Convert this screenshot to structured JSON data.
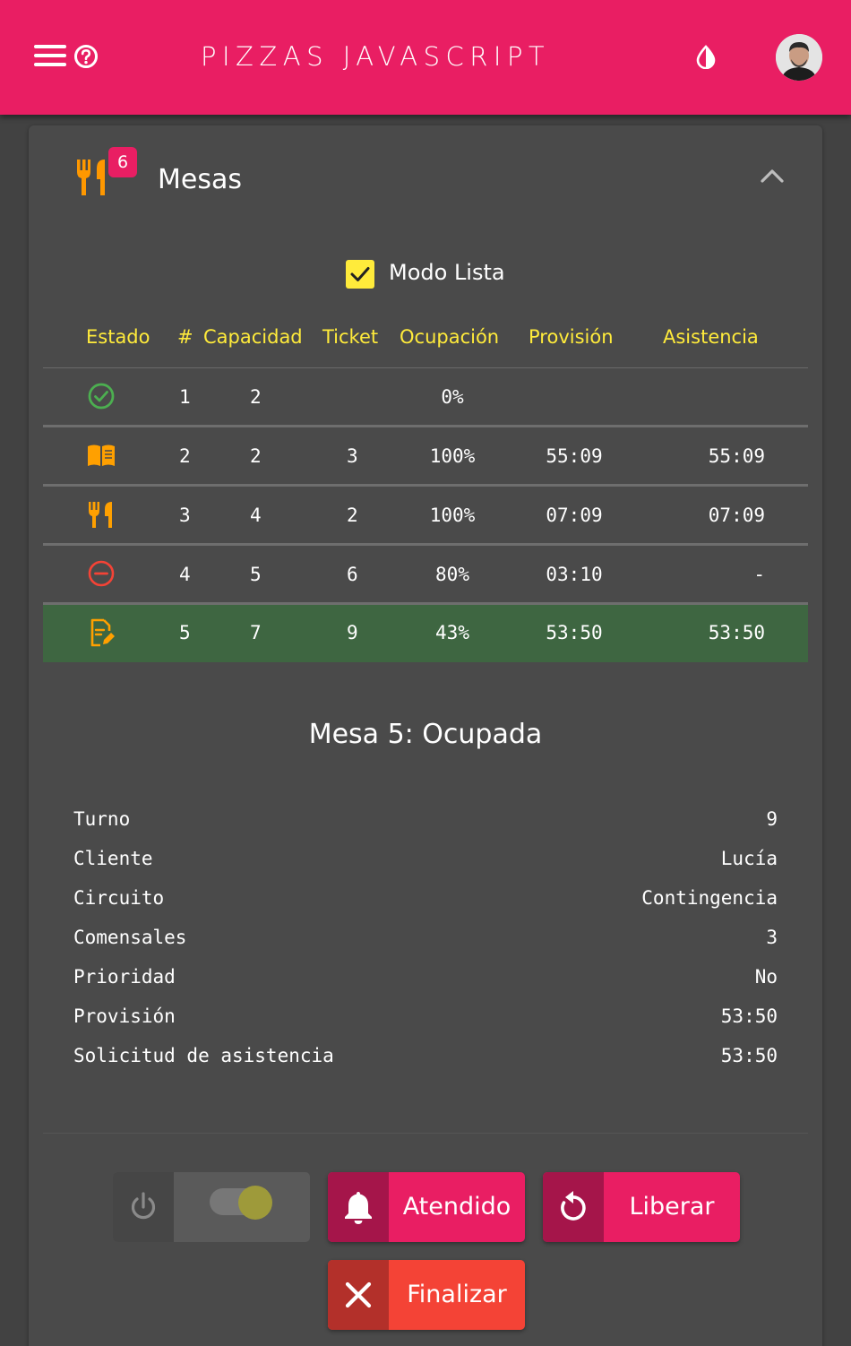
{
  "header": {
    "title": "PIZZAS JAVASCRIPT",
    "menu_icon": "menu-icon",
    "help_icon": "help-icon",
    "theme_icon": "contrast-icon",
    "avatar": "user-avatar"
  },
  "panel": {
    "title": "Mesas",
    "badge": "6",
    "icon": "utensils-icon",
    "collapse_icon": "chevron-up-icon"
  },
  "list_mode": {
    "label": "Modo Lista",
    "checked": true
  },
  "table": {
    "headers": [
      "Estado",
      "#",
      "Capacidad",
      "Ticket",
      "Ocupación",
      "Provisión",
      "Asistencia"
    ],
    "rows": [
      {
        "status": "check-circle-icon",
        "num": "1",
        "capacity": "2",
        "ticket": "",
        "occupancy": "0%",
        "provision": "",
        "assistance": ""
      },
      {
        "status": "menu-book-icon",
        "num": "2",
        "capacity": "2",
        "ticket": "3",
        "occupancy": "100%",
        "provision": "55:09",
        "assistance": "55:09"
      },
      {
        "status": "utensils-icon",
        "num": "3",
        "capacity": "4",
        "ticket": "2",
        "occupancy": "100%",
        "provision": "07:09",
        "assistance": "07:09"
      },
      {
        "status": "minus-circle-icon",
        "num": "4",
        "capacity": "5",
        "ticket": "6",
        "occupancy": "80%",
        "provision": "03:10",
        "assistance": "-"
      },
      {
        "status": "edit-note-icon",
        "num": "5",
        "capacity": "7",
        "ticket": "9",
        "occupancy": "43%",
        "provision": "53:50",
        "assistance": "53:50"
      }
    ],
    "selected_row": 4
  },
  "detail": {
    "title": "Mesa 5: Ocupada",
    "fields": [
      {
        "key": "Turno",
        "value": "9"
      },
      {
        "key": "Cliente",
        "value": "Lucía"
      },
      {
        "key": "Circuito",
        "value": "Contingencia"
      },
      {
        "key": "Comensales",
        "value": "3"
      },
      {
        "key": "Prioridad",
        "value": "No"
      },
      {
        "key": "Provisión",
        "value": "53:50"
      },
      {
        "key": "Solicitud de asistencia",
        "value": "53:50"
      }
    ]
  },
  "actions": {
    "power_icon": "power-icon",
    "toggle_on": true,
    "attended": "Atendido",
    "release": "Liberar",
    "finish": "Finalizar"
  },
  "colors": {
    "accent": "#e91e63",
    "header_text": "#ffeb3b",
    "selected_row": "#3e6641",
    "danger": "#f44336",
    "ok": "#4caf50",
    "warning": "#ffa000",
    "background": "#424242",
    "card": "#4a4a4a"
  }
}
